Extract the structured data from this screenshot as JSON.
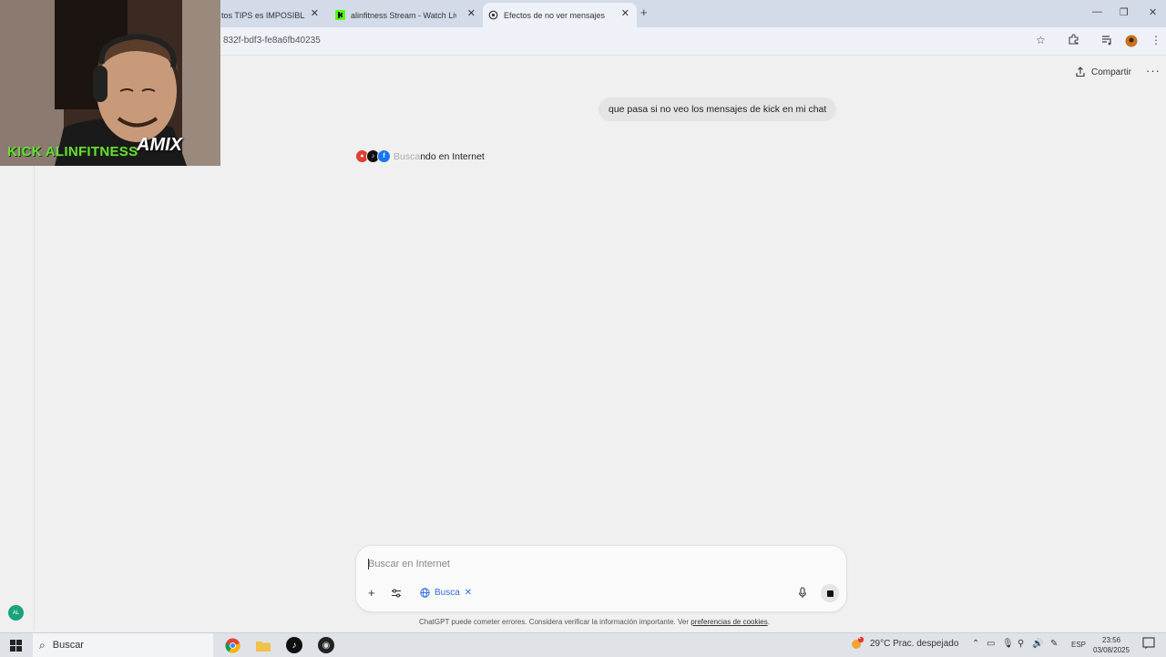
{
  "browser": {
    "tabs": [
      {
        "label": "tos TIPS es IMPOSIBLE f...",
        "active": false
      },
      {
        "label": "alinfitness Stream - Watch Live",
        "active": false
      },
      {
        "label": "Efectos de no ver mensajes",
        "active": true
      }
    ],
    "new_tab_glyph": "+",
    "url_fragment": "832f-bdf3-fe8a6fb40235"
  },
  "page": {
    "share_label": "Compartir",
    "user_message": "que pasa si no veo los mensajes de kick en mi chat",
    "searching_status": {
      "dim": "Busca",
      "rest": "ndo en Internet"
    },
    "composer": {
      "placeholder": "Buscar en Internet",
      "chip_label": "Busca"
    },
    "disclaimer": {
      "text": "ChatGPT puede cometer errores. Considera verificar la información importante. Ver ",
      "link": "preferencias de cookies",
      "end": "."
    },
    "avatar_initials": "AL"
  },
  "overlay": {
    "name": "KICK ALINFITNESS",
    "brand": "AMIX"
  },
  "taskbar": {
    "search_label": "Buscar",
    "weather": "29°C  Prac. despejado",
    "weather_badge": "1",
    "lang": "ESP",
    "time": "23:56",
    "date": "03/08/2025",
    "notif_count": "1"
  },
  "colors": {
    "accent_blue": "#2f6fde",
    "kick_green": "#53fc18",
    "avatar_green": "#19a37a"
  }
}
